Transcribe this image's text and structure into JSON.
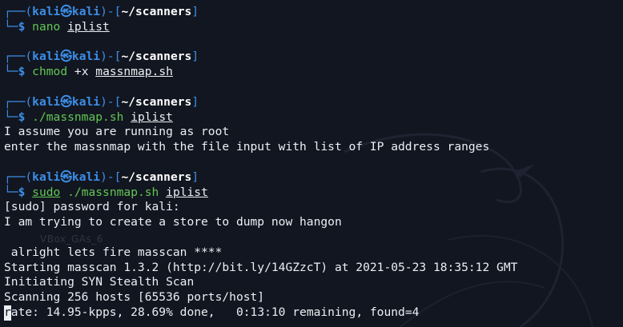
{
  "prompt": {
    "corner_top": "┌──(",
    "user": "kali",
    "skull": "㉿",
    "host": "kali",
    "mid": ")-[",
    "path": "~/scanners",
    "close": "]",
    "corner_bottom": "└─",
    "dollar": "$"
  },
  "blocks": [
    {
      "command": "nano",
      "args": "",
      "underlined_arg": "iplist",
      "output": []
    },
    {
      "command": "chmod",
      "args": "+x",
      "underlined_arg": "massnmap.sh",
      "output": []
    },
    {
      "command": "./massnmap.sh",
      "args": "",
      "underlined_arg": "iplist",
      "output": [
        "I assume you are running as root",
        "enter the massnmap with the file input with list of IP address ranges"
      ]
    },
    {
      "command_underlined": "sudo",
      "command": "./massnmap.sh",
      "underlined_arg": "iplist",
      "output": [
        "[sudo] password for kali:",
        "I am trying to create a store to dump now hangon",
        "",
        " alright lets fire masscan ****",
        "Starting masscan 1.3.2 (http://bit.ly/14GZzcT) at 2021-05-23 18:35:12 GMT",
        "Initiating SYN Stealth Scan",
        "Scanning 256 hosts [65536 ports/host]"
      ]
    }
  ],
  "status_line": {
    "cursor_char": "r",
    "text": "ate: 14.95-kpps, 28.69% done,   0:13:10 remaining, found=4"
  },
  "ghost_text": "VBox_GAs_6",
  "colors": {
    "background": "#121620",
    "prompt_blue": "#3c8ee8",
    "command_green": "#62c654",
    "text": "#eceff4"
  }
}
